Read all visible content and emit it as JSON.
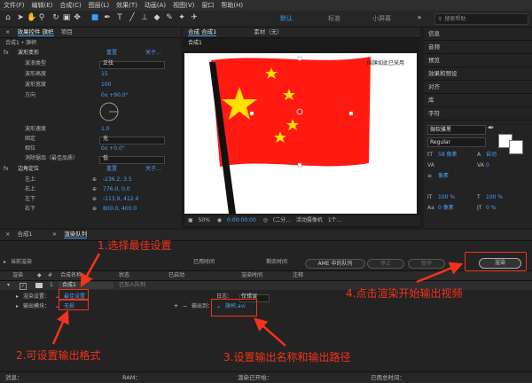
{
  "menu": [
    "文件(F)",
    "编辑(E)",
    "合成(C)",
    "图层(L)",
    "效果(T)",
    "动画(A)",
    "视图(V)",
    "窗口",
    "帮助(H)"
  ],
  "workspaces": {
    "default": "默认",
    "standard": "标准",
    "small": "小屏幕",
    "search": "搜索帮助"
  },
  "effects_panel": {
    "tab_effects": "效果控件 旗帜",
    "tab_project": "项目",
    "breadcrumb": "合成1 • 旗帜",
    "effect_name": "波形变形",
    "reset": "重置",
    "about": "关于...",
    "params": [
      {
        "label": "波浪类型",
        "value": "正弦"
      },
      {
        "label": "波形高度",
        "value": "15"
      },
      {
        "label": "波形宽度",
        "value": "100"
      },
      {
        "label": "方向",
        "value": "0x +90.0°"
      },
      {
        "label": "波形速度",
        "value": "1.0"
      },
      {
        "label": "固定",
        "value": "无"
      },
      {
        "label": "相位",
        "value": "0x +0.0°"
      },
      {
        "label": "消除锯齿（最佳品质）",
        "value": "低"
      }
    ],
    "corner_effect": "边角定位",
    "corners": [
      {
        "label": "左上",
        "value": "-236.2, 3.5"
      },
      {
        "label": "右上",
        "value": "776.0, 0.0"
      },
      {
        "label": "左下",
        "value": "-113.9, 412.4"
      },
      {
        "label": "右下",
        "value": "800.0, 400.0"
      }
    ]
  },
  "composition": {
    "tab": "合成 合成1",
    "footage_tab": "素材（无）",
    "subtab": "合成1",
    "watermark": "国旗如此已采用",
    "zoom": "50%",
    "timecode": "0:00:00:00",
    "quality": "(二分...",
    "view": "活动摄像机",
    "views": "1个..."
  },
  "right_panel": {
    "items": [
      "信息",
      "音频",
      "预览",
      "效果和预设",
      "对齐",
      "库",
      "字符"
    ],
    "font": "微软雅黑",
    "style": "Regular",
    "size": "58 像素",
    "leading": "自动",
    "tracking": "0",
    "stroke": "像素",
    "scale_v": "100 %",
    "scale_h": "100 %",
    "baseline": "0 像素",
    "tsume": "0 %"
  },
  "render_queue": {
    "tab_comp": "合成1",
    "tab_render": "渲染队列",
    "current_render": "当前渲染",
    "elapsed": "已用时间",
    "remaining": "剩余时间",
    "ame_button": "AME 中的队列",
    "stop": "停止",
    "pause": "暂停",
    "render_button": "渲染",
    "cols": [
      "渲染",
      "合成名称",
      "状态",
      "已启动",
      "渲染时间",
      "注释"
    ],
    "item_num": "1",
    "item_name": "合成1",
    "item_status": "已加入队列",
    "render_settings_label": "渲染设置：",
    "render_settings_value": "最佳设置",
    "output_module_label": "输出模块：",
    "output_module_value": "无损",
    "log_label": "日志：",
    "log_value": "仅错误",
    "output_to_label": "输出到：",
    "output_to_value": "旗帜.avi"
  },
  "status_bar": {
    "message": "消息：",
    "ram": "RAM：",
    "render_start": "渲染已开始：",
    "total_time": "已用总时间："
  },
  "annotations": {
    "step1": "1.选择最佳设置",
    "step2": "2.可设置输出格式",
    "step3": "3.设置输出名称和输出路径",
    "step4": "4.点击渲染开始输出视频"
  },
  "colors": {
    "annotation": "#f5321b",
    "accent": "#3b9cff",
    "flag_red": "#ff1a12",
    "flag_star": "#ffe000"
  }
}
